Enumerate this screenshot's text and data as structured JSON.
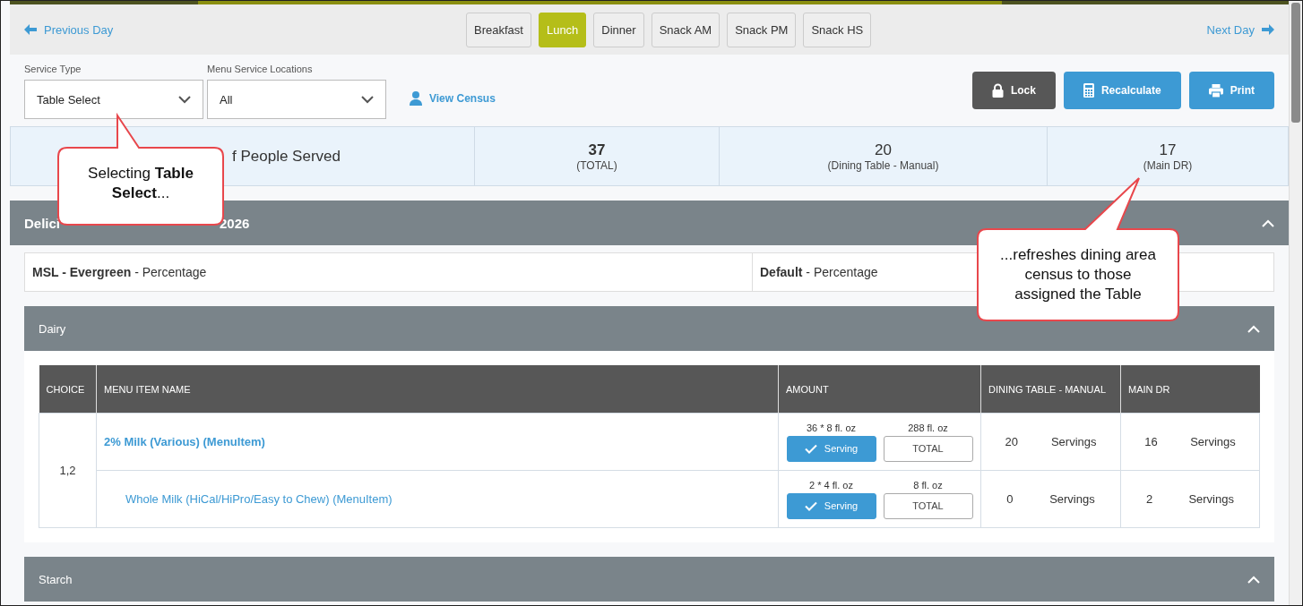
{
  "nav": {
    "previous": "Previous Day",
    "next": "Next Day",
    "meals": [
      {
        "label": "Breakfast",
        "selected": false
      },
      {
        "label": "Lunch",
        "selected": true
      },
      {
        "label": "Dinner",
        "selected": false
      },
      {
        "label": "Snack AM",
        "selected": false
      },
      {
        "label": "Snack PM",
        "selected": false
      },
      {
        "label": "Snack HS",
        "selected": false
      }
    ]
  },
  "filters": {
    "service_type": {
      "label": "Service Type",
      "value": "Table Select"
    },
    "locations": {
      "label": "Menu Service Locations",
      "value": "All"
    },
    "view_census": "View Census"
  },
  "actions": [
    {
      "label": "Lock",
      "kind": "lock"
    },
    {
      "label": "Recalculate",
      "kind": "recalculate"
    },
    {
      "label": "Print",
      "kind": "print"
    }
  ],
  "census": {
    "label": "f People Served",
    "counts": [
      {
        "value": "37",
        "caption": "(TOTAL)",
        "emphasized": true
      },
      {
        "value": "20",
        "caption": "(Dining Table - Manual)",
        "emphasized": false
      },
      {
        "value": "17",
        "caption": "(Main DR)",
        "emphasized": false
      }
    ]
  },
  "section": {
    "title_start": "Delici",
    "title_end": "2026",
    "expanded": true,
    "locations": [
      {
        "name": "MSL - Evergreen",
        "type": "- Percentage"
      },
      {
        "name": "Default",
        "type": "- Percentage"
      }
    ],
    "groups": [
      {
        "title": "Dairy",
        "expanded": true,
        "table": {
          "columns": [
            "CHOICE",
            "MENU ITEM NAME",
            "AMOUNT",
            "DINING TABLE - MANUAL",
            "MAIN DR"
          ],
          "choices": [
            {
              "choice": "1,2",
              "items": [
                {
                  "name": "2% Milk (Various) (MenuItem)",
                  "per_serving": "36 * 8 fl. oz",
                  "total": "288 fl. oz",
                  "serving": {
                    "label": "Serving",
                    "selected": true
                  },
                  "total_button": {
                    "label": "TOTAL",
                    "selected": false
                  },
                  "dining": {
                    "count": "20",
                    "unit": "Servings"
                  },
                  "main": {
                    "count": "16",
                    "unit": "Servings"
                  },
                  "children": [
                    {
                      "name": "Whole Milk (HiCal/HiPro/Easy to Chew) (MenuItem)",
                      "per_serving": "2 * 4 fl. oz",
                      "total": "8 fl. oz",
                      "serving": {
                        "label": "Serving",
                        "selected": true
                      },
                      "total_button": {
                        "label": "TOTAL",
                        "selected": false
                      },
                      "dining": {
                        "count": "0",
                        "unit": "Servings"
                      },
                      "main": {
                        "count": "2",
                        "unit": "Servings"
                      }
                    }
                  ]
                }
              ]
            }
          ]
        }
      },
      {
        "title": "Starch",
        "expanded": true
      }
    ]
  },
  "callouts": [
    {
      "text": "Selecting **Table Select**..."
    },
    {
      "text": "...refreshes dining area census to those assigned the Table"
    }
  ]
}
